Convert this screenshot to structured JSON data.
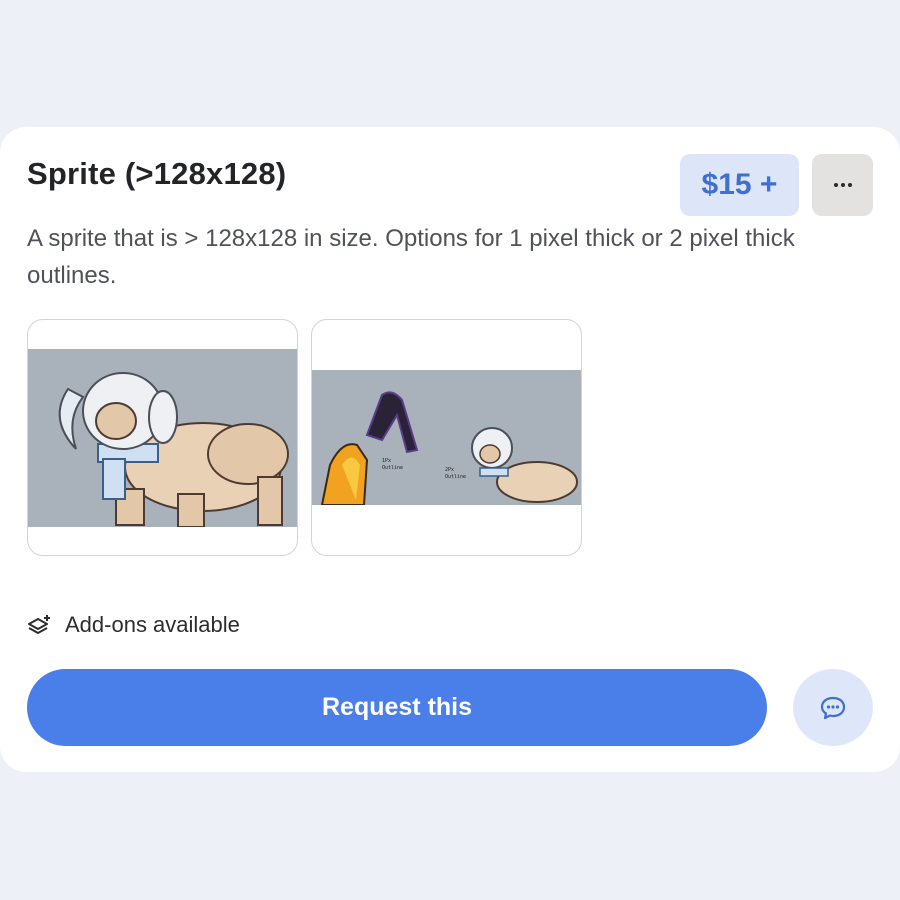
{
  "product": {
    "title": "Sprite (>128x128)",
    "price": "$15 +",
    "description": "A sprite that is > 128x128 in size. Options for 1 pixel thick or 2 pixel thick outlines."
  },
  "gallery": {
    "images": [
      {
        "name": "sprite-creature-image"
      },
      {
        "name": "sprite-outline-comparison-image",
        "annotations": [
          "1Px Outline",
          "2Px Outline"
        ]
      }
    ]
  },
  "addons": {
    "label": "Add-ons available",
    "icon": "layers-plus-icon"
  },
  "actions": {
    "request_label": "Request this",
    "more_icon": "ellipsis-icon",
    "chat_icon": "chat-bubble-icon"
  },
  "colors": {
    "background": "#edf0f6",
    "card": "#ffffff",
    "accent": "#4a7ee8",
    "price_bg": "#dde6f8",
    "price_text": "#3f6fd1"
  }
}
